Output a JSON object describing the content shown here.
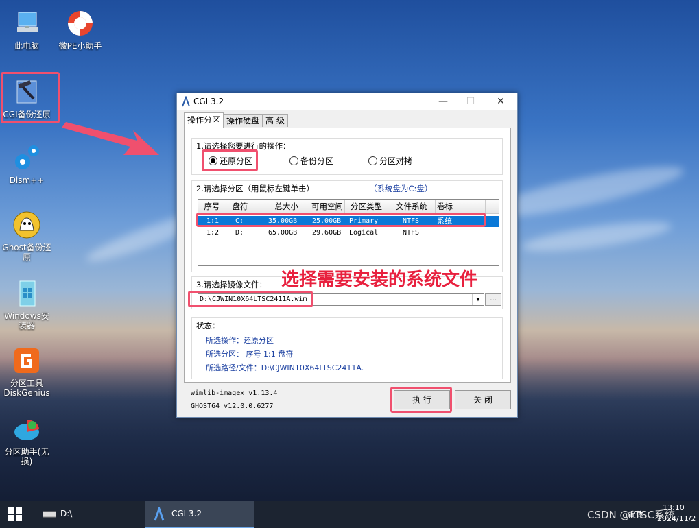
{
  "desktop": {
    "icons": [
      {
        "label": "此电脑",
        "icon": "computer-icon"
      },
      {
        "label": "微PE小助手",
        "icon": "lifebuoy-icon"
      },
      {
        "label": "CGI备份还原",
        "icon": "cgi-icon"
      },
      {
        "label": "Dism++",
        "icon": "gears-icon"
      },
      {
        "label": "Ghost备份还原",
        "icon": "ghost-icon"
      },
      {
        "label": "Windows安装器",
        "icon": "windows-installer-icon"
      },
      {
        "label": "分区工具DiskGenius",
        "icon": "diskgenius-icon"
      },
      {
        "label": "分区助手(无损)",
        "icon": "partition-assistant-icon"
      }
    ]
  },
  "annotation": {
    "label": "选择需要安装的系统文件"
  },
  "window": {
    "title": "CGI 3.2",
    "tabs": [
      "操作分区",
      "操作硬盘",
      "高 级"
    ],
    "step1": {
      "caption": "1.请选择您要进行的操作：",
      "options": [
        "还原分区",
        "备份分区",
        "分区对拷"
      ],
      "selected": 0
    },
    "step2": {
      "caption": "2.请选择分区（用鼠标左键单击）",
      "hint": "（系统盘为C:盘）",
      "columns": [
        "序号",
        "盘符",
        "总大小",
        "可用空间",
        "分区类型",
        "文件系统",
        "卷标"
      ],
      "rows": [
        {
          "idx": "1:1",
          "drive": "C:",
          "total": "35.00GB",
          "free": "25.00GB",
          "type": "Primary",
          "fs": "NTFS",
          "label": "系统",
          "selected": true
        },
        {
          "idx": "1:2",
          "drive": "D:",
          "total": "65.00GB",
          "free": "29.60GB",
          "type": "Logical",
          "fs": "NTFS",
          "label": "",
          "selected": false
        }
      ]
    },
    "step3": {
      "caption": "3.请选择镜像文件：",
      "image_path": "D:\\CJWIN10X64LTSC2411A.wim",
      "browse_label": "..."
    },
    "status": {
      "caption": "状态：",
      "op_line": "所选操作：还原分区",
      "part_line": "所选分区：  序号 1:1       盘符",
      "path_line": "所选路径/文件：D:\\CJWIN10X64LTSC2411A."
    },
    "versions": [
      "wimlib-imagex v1.13.4",
      "GHOST64 v12.0.0.6277"
    ],
    "execute_label": "执 行",
    "close_label": "关 闭"
  },
  "taskbar": {
    "drive_label": "D:\\",
    "app_label": "CGI 3.2",
    "ime_label": "简体",
    "time": "13:10",
    "date": "2024/11/2",
    "watermark": "CSDN @LTSC系统"
  },
  "colors": {
    "highlight": "#f0506e",
    "selection": "#0a78d7",
    "status_text": "#1a3fa0"
  }
}
